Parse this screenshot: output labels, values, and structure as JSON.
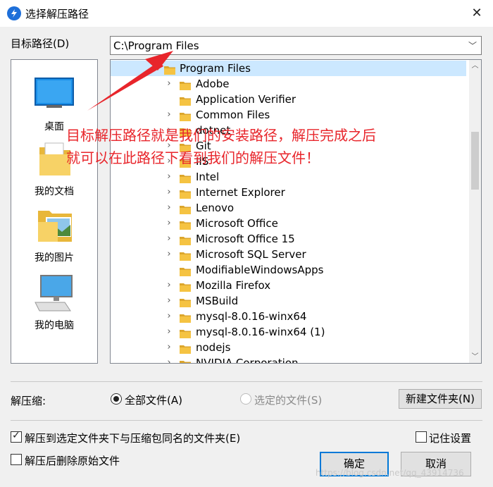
{
  "window": {
    "title": "选择解压路径",
    "close_glyph": "✕"
  },
  "path": {
    "label": "目标路径(D)",
    "value": "C:\\Program Files"
  },
  "places": [
    {
      "label": "桌面",
      "icon": "desktop-icon"
    },
    {
      "label": "我的文档",
      "icon": "documents-folder-icon"
    },
    {
      "label": "我的图片",
      "icon": "pictures-folder-icon"
    },
    {
      "label": "我的电脑",
      "icon": "computer-icon"
    }
  ],
  "tree": {
    "root": "Program Files",
    "items": [
      {
        "label": "Adobe",
        "expandable": true
      },
      {
        "label": "Application Verifier",
        "expandable": false
      },
      {
        "label": "Common Files",
        "expandable": true
      },
      {
        "label": "dotnet",
        "expandable": true
      },
      {
        "label": "Git",
        "expandable": true
      },
      {
        "label": "IIS",
        "expandable": true
      },
      {
        "label": "Intel",
        "expandable": true
      },
      {
        "label": "Internet Explorer",
        "expandable": true
      },
      {
        "label": "Lenovo",
        "expandable": true
      },
      {
        "label": "Microsoft Office",
        "expandable": true
      },
      {
        "label": "Microsoft Office 15",
        "expandable": true
      },
      {
        "label": "Microsoft SQL Server",
        "expandable": true
      },
      {
        "label": "ModifiableWindowsApps",
        "expandable": false
      },
      {
        "label": "Mozilla Firefox",
        "expandable": true
      },
      {
        "label": "MSBuild",
        "expandable": true
      },
      {
        "label": "mysql-8.0.16-winx64",
        "expandable": true
      },
      {
        "label": "mysql-8.0.16-winx64 (1)",
        "expandable": true
      },
      {
        "label": "nodejs",
        "expandable": true
      },
      {
        "label": "NVIDIA Corporation",
        "expandable": true
      }
    ]
  },
  "annotation": {
    "line1": "目标解压路径就是我们的安装路径，解压完成之后",
    "line2": "就可以在此路径下看到我们的解压文件！",
    "color": "#e8252b"
  },
  "extract": {
    "label": "解压缩:",
    "all_files": "全部文件(A)",
    "selected_files": "选定的文件(S)",
    "new_folder_button": "新建文件夹(N)"
  },
  "options": {
    "extract_to_subfolder": {
      "label": "解压到选定文件夹下与压缩包同名的文件夹(E)",
      "checked": true
    },
    "delete_after": {
      "label": "解压后删除原始文件",
      "checked": false
    },
    "remember": {
      "label": "记住设置",
      "checked": false
    }
  },
  "buttons": {
    "ok": "确定",
    "cancel": "取消"
  },
  "watermark": "https://blog.csdn.net/qq_43914736",
  "colors": {
    "accent": "#0078d7",
    "selection": "#cce8ff",
    "folder": "#f5c342"
  }
}
